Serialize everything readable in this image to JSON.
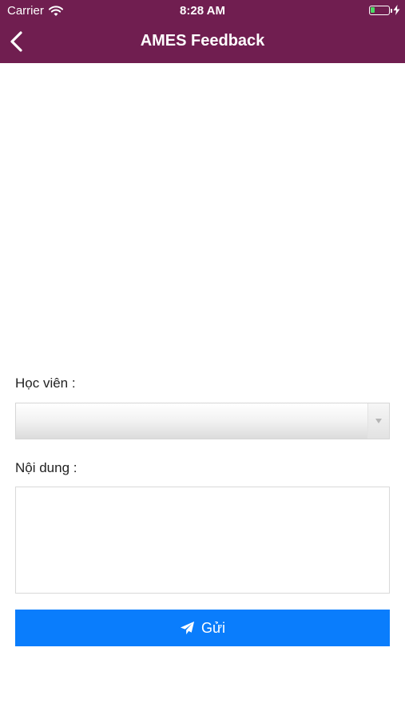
{
  "status_bar": {
    "carrier": "Carrier",
    "time": "8:28 AM",
    "battery_level": 0.25,
    "icons": [
      "wifi-icon",
      "battery-icon",
      "charging-bolt-icon"
    ]
  },
  "nav": {
    "title": "AMES Feedback",
    "back_icon": "chevron-left-icon",
    "background_color": "#701e50"
  },
  "form": {
    "student_label": "Học viên :",
    "student_select": {
      "value": "",
      "arrow_icon": "caret-down-icon"
    },
    "content_label": "Nội dung :",
    "content_textarea": {
      "value": "",
      "placeholder": ""
    },
    "submit": {
      "label": "Gửi",
      "icon": "paper-plane-icon",
      "color": "#0a7dfc"
    }
  }
}
